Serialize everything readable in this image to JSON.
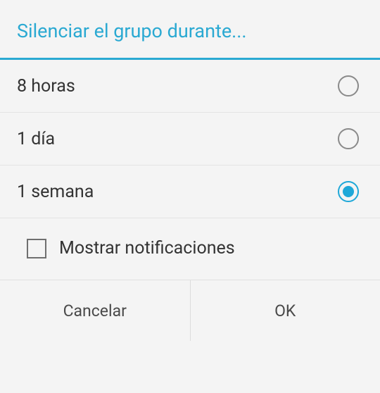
{
  "dialog": {
    "title": "Silenciar el grupo durante...",
    "options": [
      {
        "label": "8 horas",
        "selected": false
      },
      {
        "label": "1 día",
        "selected": false
      },
      {
        "label": "1 semana",
        "selected": true
      }
    ],
    "checkbox": {
      "label": "Mostrar notificaciones",
      "checked": false
    },
    "actions": {
      "cancel": "Cancelar",
      "ok": "OK"
    }
  }
}
